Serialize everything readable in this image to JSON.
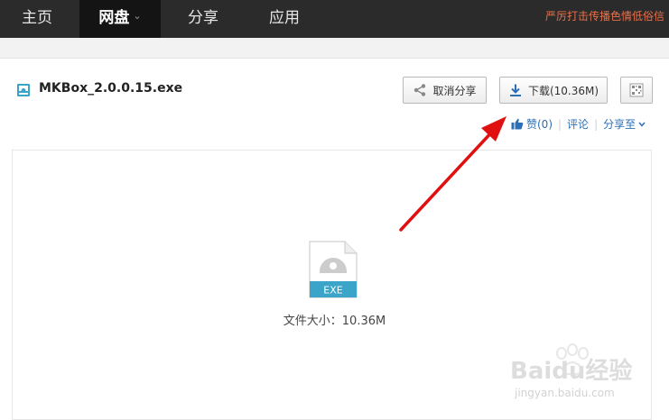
{
  "nav": {
    "home": "主页",
    "netdisk": "网盘",
    "share": "分享",
    "apps": "应用",
    "notice": "严厉打击传播色情低俗信"
  },
  "file": {
    "name": "MKBox_2.0.0.15.exe",
    "type_badge": "EXE",
    "size_text": "文件大小：10.36M"
  },
  "toolbar": {
    "cancel_share_label": "取消分享",
    "download_label": "下载(10.36M)"
  },
  "actions": {
    "like_label": "赞(0)",
    "comment_label": "评论",
    "share_to_label": "分享至"
  },
  "watermark": {
    "brand": "Baidu经验",
    "url": "jingyan.baidu.com"
  },
  "colors": {
    "topbar": "#2b2b2b",
    "link": "#2b6fb6",
    "notice": "#e8704a",
    "exe_badge": "#3aa5c8",
    "annotation": "#e01010"
  }
}
